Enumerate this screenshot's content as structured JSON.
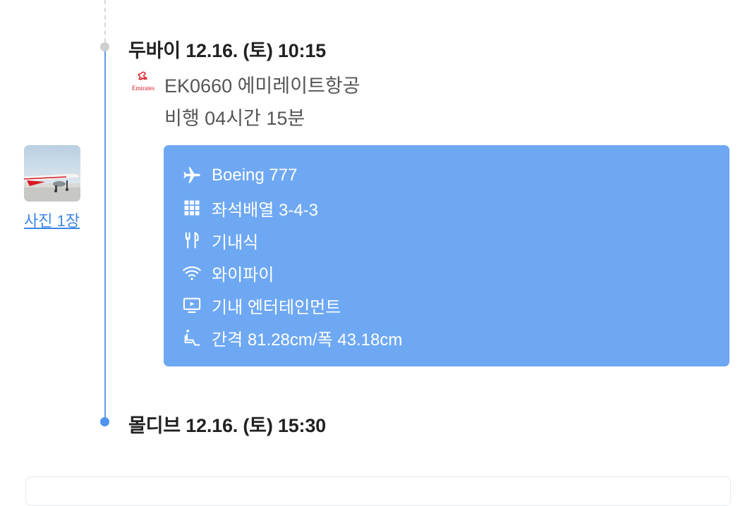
{
  "timeline": {
    "departure": {
      "label": "두바이 12.16. (토) 10:15"
    },
    "arrival": {
      "label": "몰디브 12.16. (토) 15:30"
    }
  },
  "flight": {
    "airline_logo_icon": "emirates-logo",
    "number_airline": "EK0660 에미레이트항공",
    "duration": "비행 04시간 15분"
  },
  "photos": {
    "link_label": "사진 1장"
  },
  "amenities": [
    {
      "icon": "airplane-icon",
      "label": "Boeing 777"
    },
    {
      "icon": "seat-grid-icon",
      "label": "좌석배열 3-4-3"
    },
    {
      "icon": "fork-knife-icon",
      "label": "기내식"
    },
    {
      "icon": "wifi-icon",
      "label": "와이파이"
    },
    {
      "icon": "monitor-icon",
      "label": "기내 엔터테인먼트"
    },
    {
      "icon": "seat-pitch-icon",
      "label": "간격 81.28cm/폭 43.18cm"
    }
  ],
  "colors": {
    "accent": "#5b9cf0",
    "info_box": "#6ea8f3",
    "link": "#3d86e8",
    "airline_red": "#d71921"
  }
}
